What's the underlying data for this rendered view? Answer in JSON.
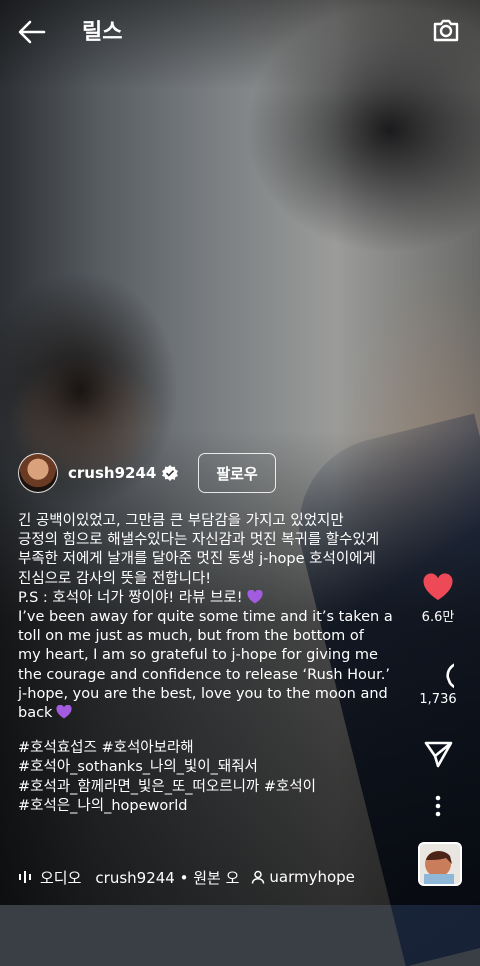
{
  "header": {
    "title": "릴스",
    "back_icon": "arrow-left-icon",
    "camera_icon": "camera-icon"
  },
  "post": {
    "username": "crush9244",
    "follow_label": "팔로우",
    "caption_lines": [
      "긴 공백이있었고, 그만큼 큰 부담감을 가지고 있었지만",
      "긍정의 힘으로 해낼수있다는 자신감과 멋진 복귀를 할수있게",
      "부족한 저에게 날개를 달아준 멋진 동생 j-hope 호석이에게",
      "진심으로 감사의 뜻을 전합니다!",
      "P.S : 호석아 너가 짱이야! 라뷰 브로!",
      "I’ve been away for quite some time and it’s taken a",
      "toll on me just as much, but from the bottom of",
      "my heart, I am so grateful to j-hope for giving me",
      "the courage and confidence to release ‘Rush Hour.’",
      "j-hope, you are the best, love you to the moon and",
      "back"
    ],
    "hashtag_lines": [
      "#호석효섭즈 #호석아보라해",
      "#호석아_sothanks_나의_빛이_돼줘서",
      "#호석과_함께라면_빛은_또_떠오르니까 #호석이",
      "#호석은_나의_hopeworld"
    ]
  },
  "actions": {
    "likes": "6.6만",
    "comments": "1,736",
    "like_color": "#ed4956"
  },
  "footer": {
    "audio_label": "오디오",
    "audio_text": "crush9244 • 원본 오",
    "tagged_user": "uarmyhope"
  }
}
